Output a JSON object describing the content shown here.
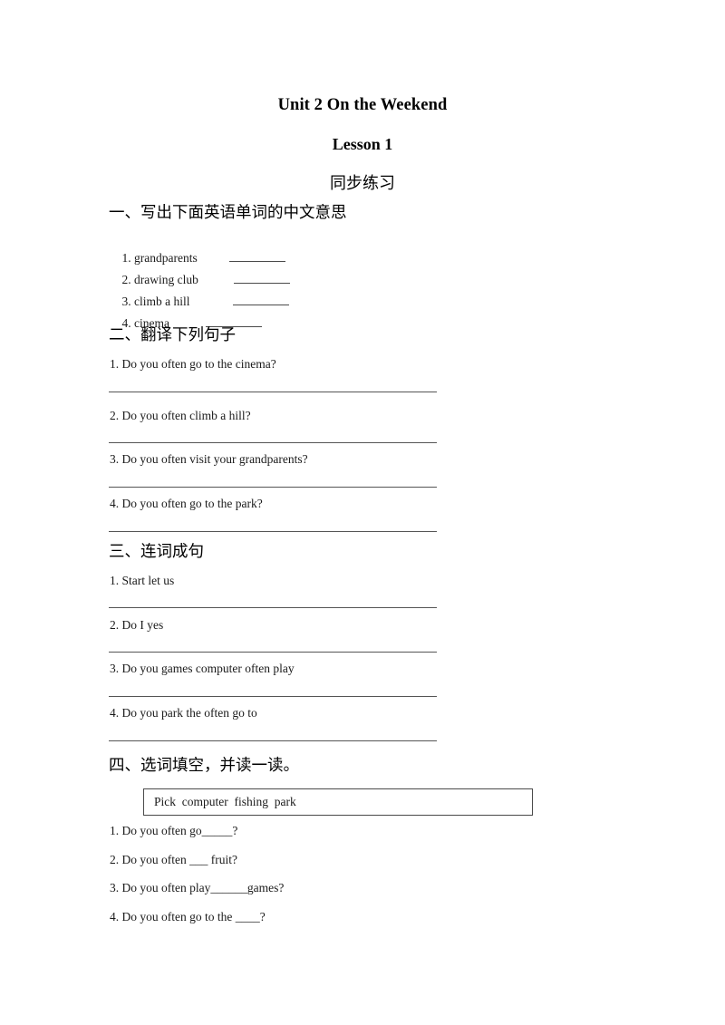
{
  "document": {
    "title": "Unit 2 On the Weekend",
    "subtitle": "Lesson 1",
    "subsubtitle": "同步练习"
  },
  "sections": [
    {
      "heading": "一、写出下面英语单词的中文意思",
      "type": "vocabulary",
      "items": [
        {
          "text": "1. grandparents",
          "blank_width": 62
        },
        {
          "text": "2. drawing club",
          "blank_width": 62
        },
        {
          "text": "3. climb a hill",
          "blank_width": 62
        },
        {
          "text": "4. cinema",
          "blank_width": 62
        }
      ]
    },
    {
      "heading": "二、翻译下列句子",
      "type": "translate",
      "items": [
        {
          "text": "1. Do you often go to the cinema?"
        },
        {
          "text": "2. Do you often climb a hill?"
        },
        {
          "text": "3. Do you often visit your grandparents?"
        },
        {
          "text": "4. Do you often go to the park?"
        }
      ]
    },
    {
      "heading": "三、连词成句",
      "type": "reorder",
      "items": [
        {
          "text": "1. Start let us"
        },
        {
          "text": "2. Do I yes"
        },
        {
          "text": "3. Do you games computer often play"
        },
        {
          "text": "4. Do you park the often go to"
        }
      ]
    },
    {
      "heading": "四、选词填空，并读一读。",
      "type": "fill-in-blank",
      "word_bank": "Pick  computer  fishing  park",
      "word_bank_words": [
        "Pick",
        "computer",
        "fishing",
        "park"
      ],
      "items": [
        {
          "text": "1. Do you often go_____?"
        },
        {
          "text": "2. Do you often ___ fruit?"
        },
        {
          "text": "3. Do you often play______games?"
        },
        {
          "text": "4. Do you often go to the ____?"
        }
      ]
    }
  ],
  "colors": {
    "text": "#1a1a1a",
    "rule": "#555555",
    "box_border": "#4a4a4a",
    "background": "#ffffff"
  }
}
